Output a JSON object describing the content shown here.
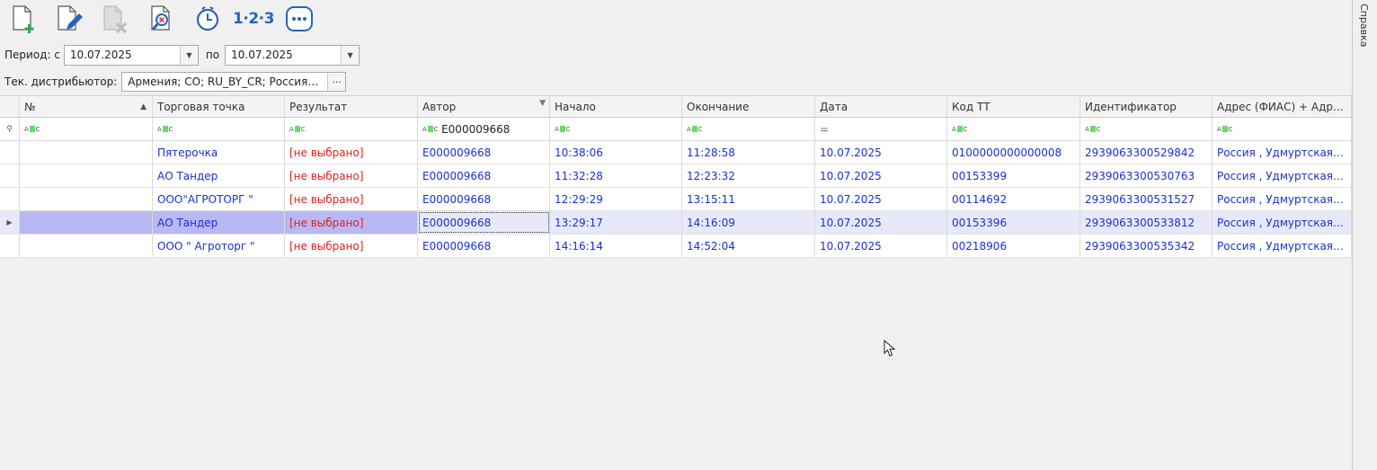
{
  "toolbar": {
    "buttons": [
      {
        "name": "add-document-button",
        "icon": "document-plus-icon"
      },
      {
        "name": "edit-document-button",
        "icon": "document-pencil-icon"
      },
      {
        "name": "delete-document-button",
        "icon": "document-x-icon"
      },
      {
        "name": "find-document-button",
        "icon": "document-search-icon"
      },
      {
        "name": "history-button",
        "icon": "clock-icon"
      },
      {
        "name": "numbering-button",
        "label": "1·2·3"
      },
      {
        "name": "more-button",
        "icon": "more-dots-icon"
      }
    ]
  },
  "filters": {
    "period_from_label": "Период: с",
    "period_from_value": "10.07.2025",
    "period_to_label": "по",
    "period_to_value": "10.07.2025",
    "distributor_label": "Тек. дистрибьютор:",
    "distributor_value": "Армения; СО; RU_BY_CR; Россия…"
  },
  "grid": {
    "columns": [
      "№",
      "Торговая точка",
      "Результат",
      "Автор",
      "Начало",
      "Окончание",
      "Дата",
      "Код ТТ",
      "Идентификатор",
      "Адрес (ФИАС) + Адр…"
    ],
    "filter_row": {
      "author_filter": "E000009668",
      "date_filter": "="
    },
    "rows": [
      {
        "num": "",
        "outlet": "Пятерочка",
        "result": "[не выбрано]",
        "author": "E000009668",
        "start": "10:38:06",
        "end": "11:28:58",
        "date": "10.07.2025",
        "code": "0100000000000008",
        "id": "2939063300529842",
        "address": "Россия , Удмуртская…"
      },
      {
        "num": "",
        "outlet": "АО Тандер",
        "result": "[не выбрано]",
        "author": "E000009668",
        "start": "11:32:28",
        "end": "12:23:32",
        "date": "10.07.2025",
        "code": "00153399",
        "id": "2939063300530763",
        "address": "Россия , Удмуртская…"
      },
      {
        "num": "",
        "outlet": "ООО\"АГРОТОРГ \"",
        "result": "[не выбрано]",
        "author": "E000009668",
        "start": "12:29:29",
        "end": "13:15:11",
        "date": "10.07.2025",
        "code": "00114692",
        "id": "2939063300531527",
        "address": "Россия , Удмуртская…"
      },
      {
        "num": "",
        "outlet": "АО Тандер",
        "result": "[не выбрано]",
        "author": "E000009668",
        "start": "13:29:17",
        "end": "14:16:09",
        "date": "10.07.2025",
        "code": "00153396",
        "id": "2939063300533812",
        "address": "Россия , Удмуртская…"
      },
      {
        "num": "",
        "outlet": "ООО \" Агроторг \"",
        "result": "[не выбрано]",
        "author": "E000009668",
        "start": "14:16:14",
        "end": "14:52:04",
        "date": "10.07.2025",
        "code": "00218906",
        "id": "2939063300535342",
        "address": "Россия , Удмуртская…"
      }
    ]
  },
  "side_panel": {
    "label": "Справка"
  },
  "colors": {
    "link_blue": "#1b2fd0",
    "not_selected_red": "#e01f1f",
    "selection": "#b8b8f4"
  }
}
